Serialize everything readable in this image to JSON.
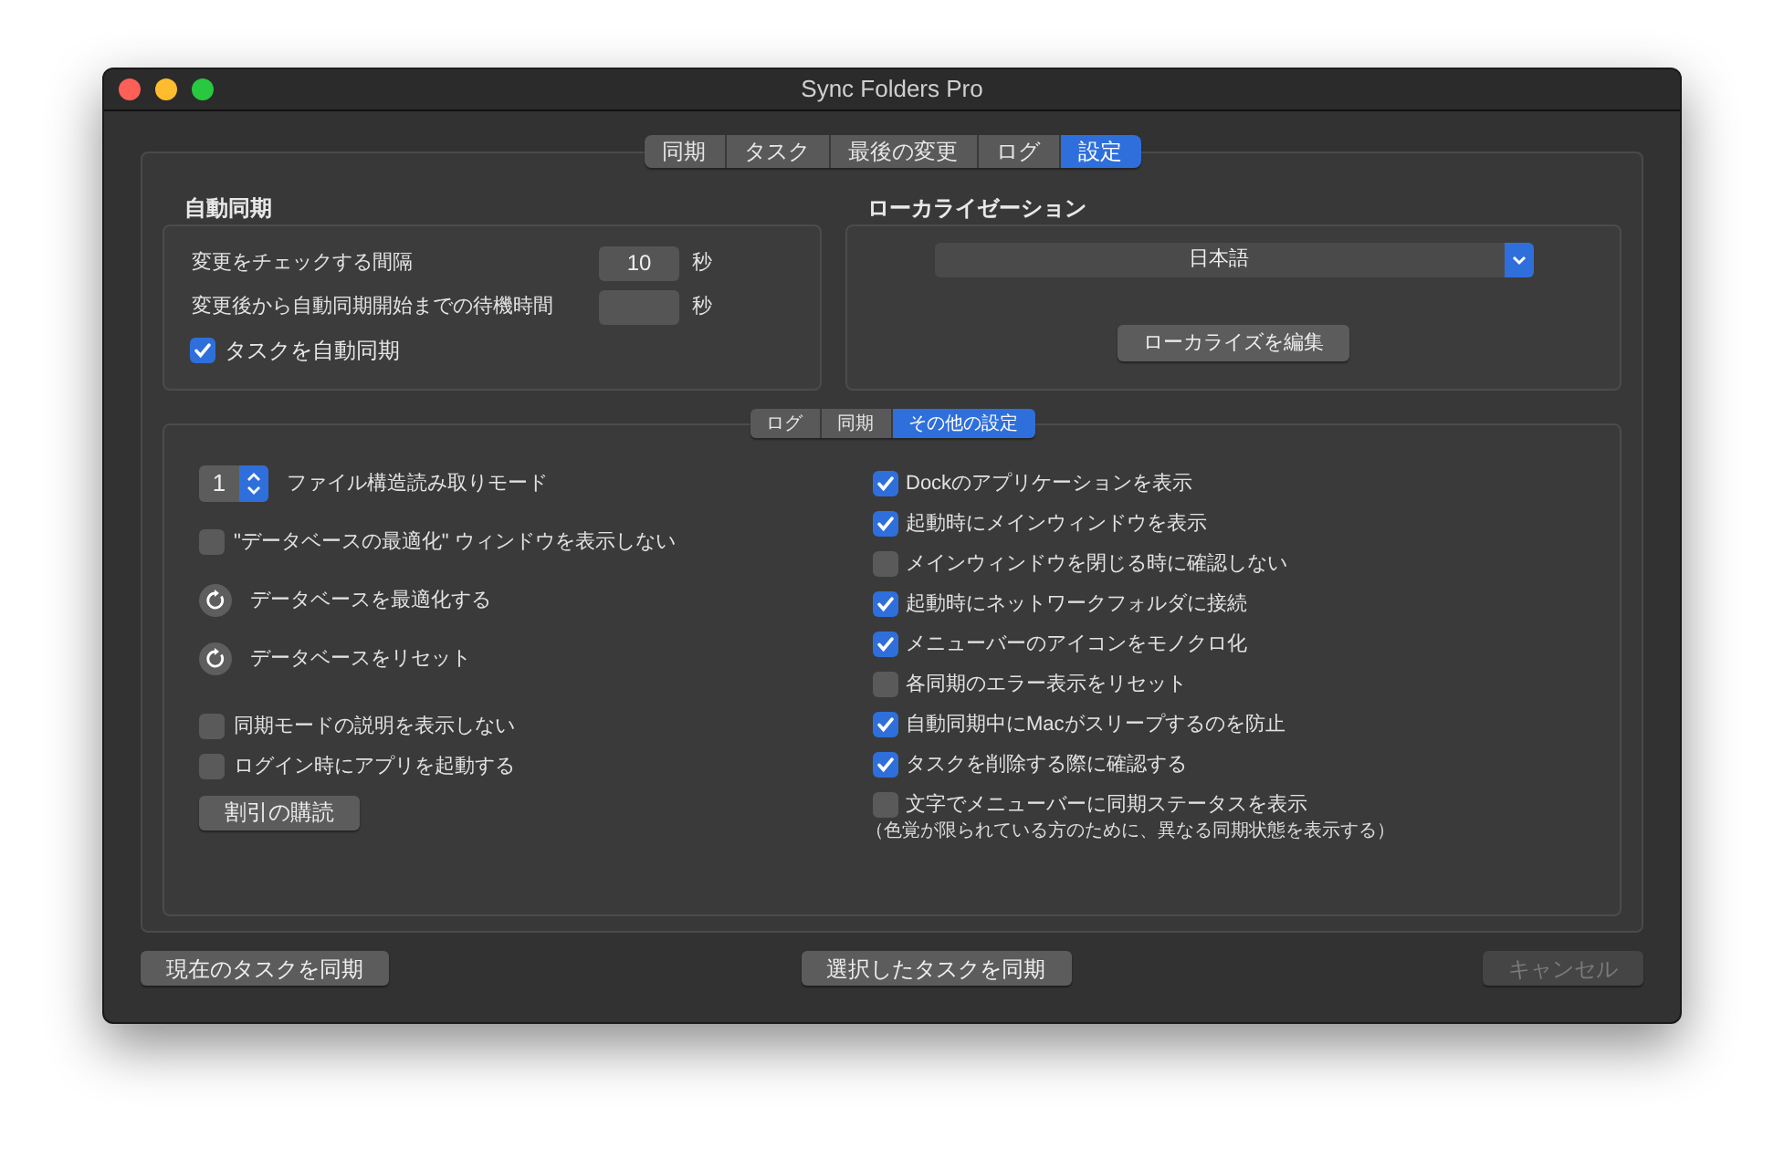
{
  "window": {
    "title": "Sync Folders Pro"
  },
  "tabs": [
    {
      "label": "同期",
      "selected": false
    },
    {
      "label": "タスク",
      "selected": false
    },
    {
      "label": "最後の変更",
      "selected": false
    },
    {
      "label": "ログ",
      "selected": false
    },
    {
      "label": "設定",
      "selected": true
    }
  ],
  "auto_sync": {
    "title": "自動同期",
    "interval_label": "変更をチェックする間隔",
    "interval_value": "10",
    "interval_unit": "秒",
    "wait_label": "変更後から自動同期開始までの待機時間",
    "wait_unit": "秒",
    "auto_sync_tasks": {
      "label": "タスクを自動同期",
      "checked": true
    }
  },
  "localization": {
    "title": "ローカライゼーション",
    "language": "日本語",
    "edit_button": "ローカライズを編集"
  },
  "sub_tabs": [
    {
      "label": "ログ",
      "selected": false
    },
    {
      "label": "同期",
      "selected": false
    },
    {
      "label": "その他の設定",
      "selected": true
    }
  ],
  "left_options": [
    {
      "kind": "stepper",
      "stepper_value": "1",
      "label": "ファイル構造読み取りモード"
    },
    {
      "kind": "checkbox",
      "label": "\"データベースの最適化\" ウィンドウを表示しない",
      "checked": false
    },
    {
      "kind": "action",
      "label": "データベースを最適化する"
    },
    {
      "kind": "action",
      "label": "データベースをリセット"
    },
    {
      "kind": "checkbox",
      "label": "同期モードの説明を表示しない",
      "checked": false
    },
    {
      "kind": "checkbox",
      "label": "ログイン時にアプリを起動する",
      "checked": false
    },
    {
      "kind": "button",
      "label": "割引の購読"
    }
  ],
  "right_options": [
    {
      "label": "Dockのアプリケーションを表示",
      "checked": true
    },
    {
      "label": "起動時にメインウィンドウを表示",
      "checked": true
    },
    {
      "label": "メインウィンドウを閉じる時に確認しない",
      "checked": false
    },
    {
      "label": "起動時にネットワークフォルダに接続",
      "checked": true
    },
    {
      "label": "メニューバーのアイコンをモノクロ化",
      "checked": true
    },
    {
      "label": "各同期のエラー表示をリセット",
      "checked": false
    },
    {
      "label": "自動同期中にMacがスリープするのを防止",
      "checked": true
    },
    {
      "label": "タスクを削除する際に確認する",
      "checked": true
    },
    {
      "label": "文字でメニューバーに同期ステータスを表示",
      "checked": false,
      "note": "（色覚が限られている方のために、異なる同期状態を表示する）"
    }
  ],
  "buttons": [
    {
      "label": "現在のタスクを同期",
      "disabled": false
    },
    {
      "label": "選択したタスクを同期",
      "disabled": false
    },
    {
      "label": "キャンセル",
      "disabled": true
    }
  ]
}
